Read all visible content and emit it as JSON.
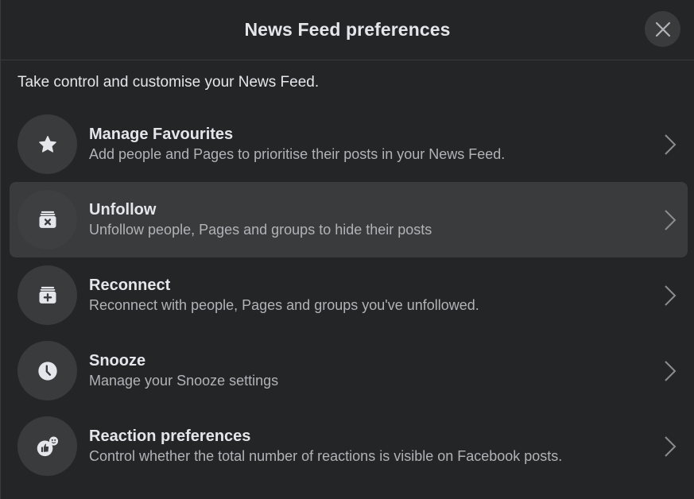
{
  "dialog": {
    "title": "News Feed preferences",
    "close_icon": "close-icon",
    "subtitle": "Take control and customise your News Feed."
  },
  "items": [
    {
      "title": "Manage Favourites",
      "description": "Add people and Pages to prioritise their posts in your News Feed.",
      "icon": "star-icon"
    },
    {
      "title": "Unfollow",
      "description": "Unfollow people, Pages and groups to hide their posts",
      "icon": "unfollow-icon"
    },
    {
      "title": "Reconnect",
      "description": "Reconnect with people, Pages and groups you've unfollowed.",
      "icon": "reconnect-icon"
    },
    {
      "title": "Snooze",
      "description": "Manage your Snooze settings",
      "icon": "clock-icon"
    },
    {
      "title": "Reaction preferences",
      "description": "Control whether the total number of reactions is visible on Facebook posts.",
      "icon": "reaction-icon"
    }
  ],
  "colors": {
    "background": "#242526",
    "surface": "#3a3b3c",
    "primary_text": "#e4e6eb",
    "secondary_text": "#b0b3b8"
  }
}
